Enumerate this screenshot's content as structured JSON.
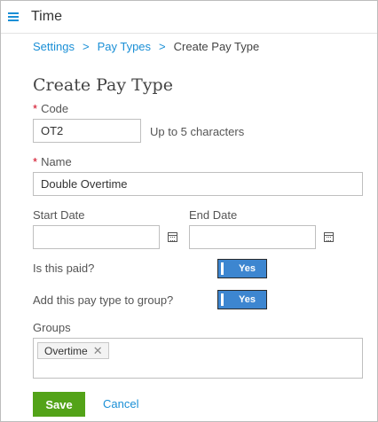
{
  "app": {
    "title": "Time"
  },
  "breadcrumb": {
    "items": [
      "Settings",
      "Pay Types"
    ],
    "separator": ">",
    "current": "Create Pay Type"
  },
  "page_title": "Create Pay Type",
  "form": {
    "code": {
      "label": "Code",
      "value": "OT2",
      "hint": "Up to 5 characters",
      "required_marker": "*"
    },
    "name": {
      "label": "Name",
      "value": "Double Overtime",
      "required_marker": "*"
    },
    "start_date": {
      "label": "Start Date",
      "value": ""
    },
    "end_date": {
      "label": "End Date",
      "value": ""
    },
    "is_paid": {
      "label": "Is this paid?",
      "toggle": "Yes"
    },
    "add_to_group": {
      "label": "Add this pay type to group?",
      "toggle": "Yes"
    },
    "groups": {
      "label": "Groups",
      "chips": [
        "Overtime"
      ],
      "remove_glyph": "✕"
    }
  },
  "actions": {
    "save": "Save",
    "cancel": "Cancel"
  },
  "colors": {
    "accent": "#1a8fd6",
    "save": "#53a318",
    "toggle": "#3d86d0",
    "required": "#d0021b"
  }
}
